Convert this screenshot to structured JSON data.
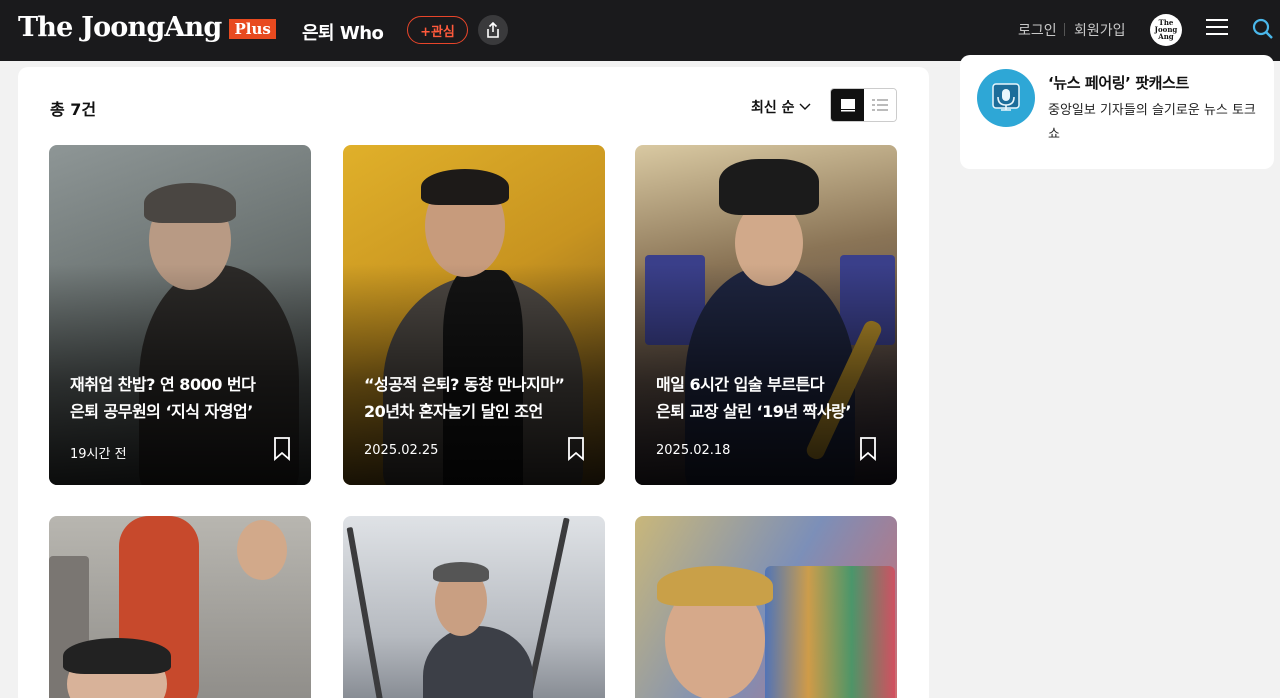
{
  "header": {
    "logo": "The JoongAng",
    "logo_badge": "Plus",
    "section_title": "은퇴 Who",
    "follow_label": "+관심",
    "login_label": "로그인",
    "signup_label": "회원가입",
    "avatar_text": "The Joong Ang"
  },
  "main": {
    "count_label": "총 7건",
    "sort_label": "최신 순",
    "cards": [
      {
        "title_line1": "재취업 찬밥? 연 8000 번다",
        "title_line2": "은퇴 공무원의 ‘지식 자영업’",
        "date": "19시간 전"
      },
      {
        "title_line1": "“성공적 은퇴? 동창 만나지마”",
        "title_line2": "20년차 혼자놀기 달인 조언",
        "date": "2025.02.25"
      },
      {
        "title_line1": "매일 6시간 입술 부르튼다",
        "title_line2": "은퇴 교장 살린 ‘19년 짝사랑’",
        "date": "2025.02.18"
      }
    ]
  },
  "sidebar": {
    "podcast_title": "‘뉴스 페어링’ 팟캐스트",
    "podcast_desc": "중앙일보 기자들의 슬기로운 뉴스 토크쇼"
  },
  "colors": {
    "header_bg": "#1a1a1c",
    "brand_accent": "#e84a1f",
    "podcast_blue": "#2ea7d6"
  },
  "icons": [
    "share-icon",
    "menu-icon",
    "search-icon",
    "chevron-down-icon",
    "card-view-icon",
    "list-view-icon",
    "bookmark-icon",
    "podcast-icon"
  ]
}
